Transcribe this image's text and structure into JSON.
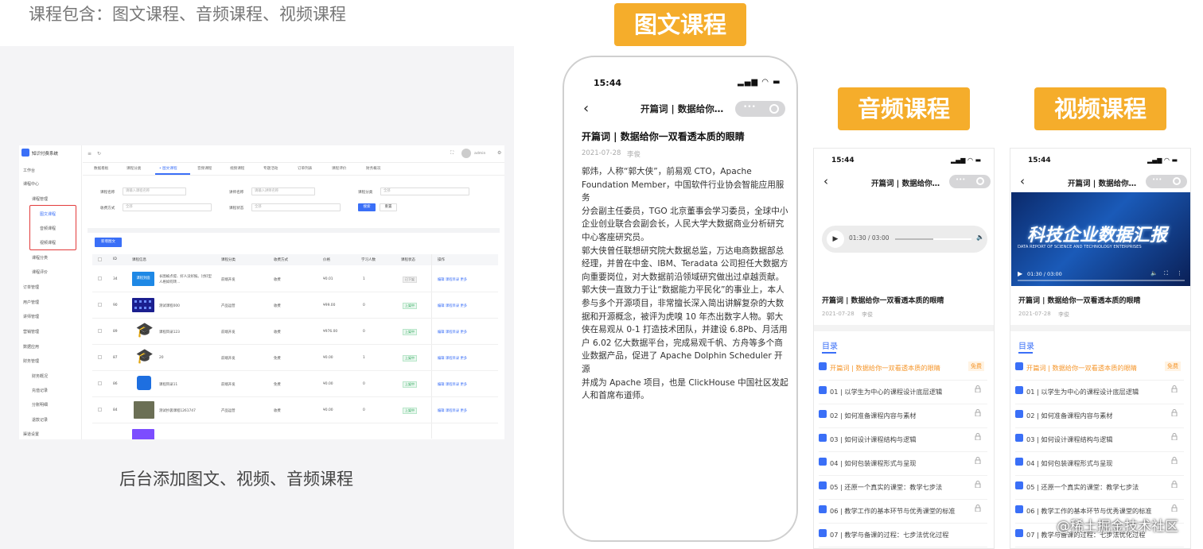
{
  "heading": "课程包含：图文课程、音频课程、视频课程",
  "caption": "后台添加图文、视频、音频课程",
  "labels": {
    "tuwen": "图文课程",
    "yinpin": "音频课程",
    "shipin": "视频课程"
  },
  "watermark": "@稀土掘金技术社区",
  "colors": {
    "orange": "#f5ad2b",
    "accent": "#3a6ff7"
  },
  "admin": {
    "app_title": "知识付费系统",
    "user": "admin",
    "sidebar": {
      "items": [
        "工作台",
        "课程中心",
        "课程管理",
        "图文课程",
        "音频课程",
        "视频课程",
        "课程分类",
        "课程评价",
        "订单管理",
        "用户管理",
        "讲师管理",
        "营销管理",
        "数据应用",
        "财务管理",
        "财务概况",
        "充值记录",
        "分账明细",
        "退款记录",
        "渠道设置"
      ]
    },
    "tabs": [
      "数据看板",
      "课程分类",
      "• 图文课程",
      "音频课程",
      "视频课程",
      "专题活动",
      "订单列表",
      "课程评价",
      "财务概况"
    ],
    "filters": {
      "course_name_label": "课程名称",
      "course_name_placeholder": "请输入课程名称",
      "teacher_label": "讲师名称",
      "teacher_placeholder": "请输入讲师名称",
      "category_label": "课程分类",
      "category_value": "全部",
      "charge_label": "收费方式",
      "charge_value": "全部",
      "status_label": "课程状态",
      "status_value": "全部",
      "search_btn": "搜索",
      "reset_btn": "重置"
    },
    "add_button": "新增图文",
    "table": {
      "headers": [
        "ID",
        "课程信息",
        "课程分类",
        "收费方式",
        "价格",
        "学习人数",
        "课程状态",
        "操作"
      ],
      "rows": [
        {
          "id": "34",
          "title": "长图被点提、好人没好报。讨好型人格如何转…",
          "thumb_text": "课程封面",
          "cat": "前端开发",
          "charge": "收费",
          "price": "¥0.01",
          "learners": "1",
          "status": "已下架",
          "status_on": false,
          "ops": "编辑 课程目录 更多"
        },
        {
          "id": "90",
          "title": "测试课程000",
          "thumb_text": "",
          "cat": "产品运营",
          "charge": "收费",
          "price": "¥99.00",
          "learners": "0",
          "status": "上架中",
          "status_on": true,
          "ops": "编辑 课程目录 更多"
        },
        {
          "id": "89",
          "title": "课程目录123",
          "thumb_text": "",
          "cat": "前端开发",
          "charge": "收费",
          "price": "¥976.00",
          "learners": "0",
          "status": "上架中",
          "status_on": true,
          "ops": "编辑 课程目录 更多"
        },
        {
          "id": "87",
          "title": "20",
          "thumb_text": "",
          "cat": "前端开发",
          "charge": "免费",
          "price": "¥0.00",
          "learners": "1",
          "status": "上架中",
          "status_on": true,
          "ops": "编辑 课程目录 更多"
        },
        {
          "id": "86",
          "title": "课程目录11",
          "thumb_text": "",
          "cat": "前端开发",
          "charge": "免费",
          "price": "¥0.00",
          "learners": "0",
          "status": "上架中",
          "status_on": true,
          "ops": "编辑 课程目录 更多"
        },
        {
          "id": "84",
          "title": "测试抄袭课程1261747",
          "thumb_text": "",
          "cat": "产品运营",
          "charge": "收费",
          "price": "¥0.00",
          "learners": "0",
          "status": "上架中",
          "status_on": true,
          "ops": "编辑 课程目录 更多"
        },
        {
          "id": "",
          "title": "",
          "thumb_text": "",
          "cat": "",
          "charge": "",
          "price": "",
          "learners": "",
          "status": "",
          "status_on": null,
          "ops": ""
        }
      ]
    }
  },
  "phone_tuwen": {
    "time": "15:44",
    "nav_title": "开篇词 | 数据给你…",
    "article_title": "开篇词 | 数据给你一双看透本质的眼睛",
    "date": "2021-07-28",
    "author": "李俊",
    "body": "郭炜，人称“郭大侠”，前易观 CTO，Apache\nFoundation Member，中国软件行业协会智能应用服务\n分会副主任委员，TGO 北京董事会学习委员，全球中小\n企业创业联合会副会长，人民大学大数据商业分析研究\n中心客座研究员。\n郭大侠曾任联想研究院大数据总监，万达电商数据部总\n经理，并曾在中金、IBM、Teradata 公司担任大数据方\n向重要岗位，对大数据前沿领域研究做出过卓越贡献。\n郭大侠一直致力于让“数据能力平民化”的事业上，本人\n参与多个开源项目，非常擅长深入简出讲解复杂的大数\n据和开源概念，被评为虎嗅 10 年杰出数字人物。郭大\n侠在易观从 0-1 打造技术团队，并建设 6.8Pb、月活用\n户 6.02 亿大数据平台，完成易观千帆、方舟等多个商\n业数据产品，促进了 Apache Dolphin Scheduler 开源\n并成为 Apache 项目，也是 ClickHouse 中国社区发起\n人和首席布道师。"
  },
  "phone_audio": {
    "time": "15:44",
    "nav_title": "开篇词 | 数据给你…",
    "player_time": "01:30 / 03:00",
    "progress": 0.5,
    "course_title": "开篇词 | 数据给你一双看透本质的眼睛",
    "date": "2021-07-28",
    "author": "李俊",
    "toc_label": "目录",
    "free_label": "免费",
    "toc": [
      "开篇词 | 数据给你一双看透本质的眼睛",
      "01 | 以学生为中心的课程设计底层逻辑",
      "02 | 如何准备课程内容与素材",
      "03 | 如何设计课程结构与逻辑",
      "04 | 如何包装课程形式与呈现",
      "05 | 还原一个真实的课堂：教学七步法",
      "06 | 教学工作的基本环节与优秀课堂的标准",
      "07 | 教学与备课的过程：七步法优化过程"
    ]
  },
  "phone_video": {
    "time": "15:44",
    "nav_title": "开篇词 | 数据给你…",
    "video_title_cn": "科技企业数据汇报",
    "video_subtitle_en": "DATA REPORT OF SCIENCE AND TECHNOLOGY ENTERPRISES",
    "video_time": "01:30 / 03:00",
    "course_title": "开篇词 | 数据给你一双看透本质的眼睛",
    "date": "2021-07-28",
    "author": "李俊",
    "toc_label": "目录",
    "free_label": "免费",
    "toc": [
      "开篇词 | 数据给你一双看透本质的眼睛",
      "01 | 以学生为中心的课程设计底层逻辑",
      "02 | 如何准备课程内容与素材",
      "03 | 如何设计课程结构与逻辑",
      "04 | 如何包装课程形式与呈现",
      "05 | 还原一个真实的课堂：教学七步法",
      "06 | 教学工作的基本环节与优秀课堂的标准",
      "07 | 教学与备课的过程：七步法优化过程"
    ]
  }
}
